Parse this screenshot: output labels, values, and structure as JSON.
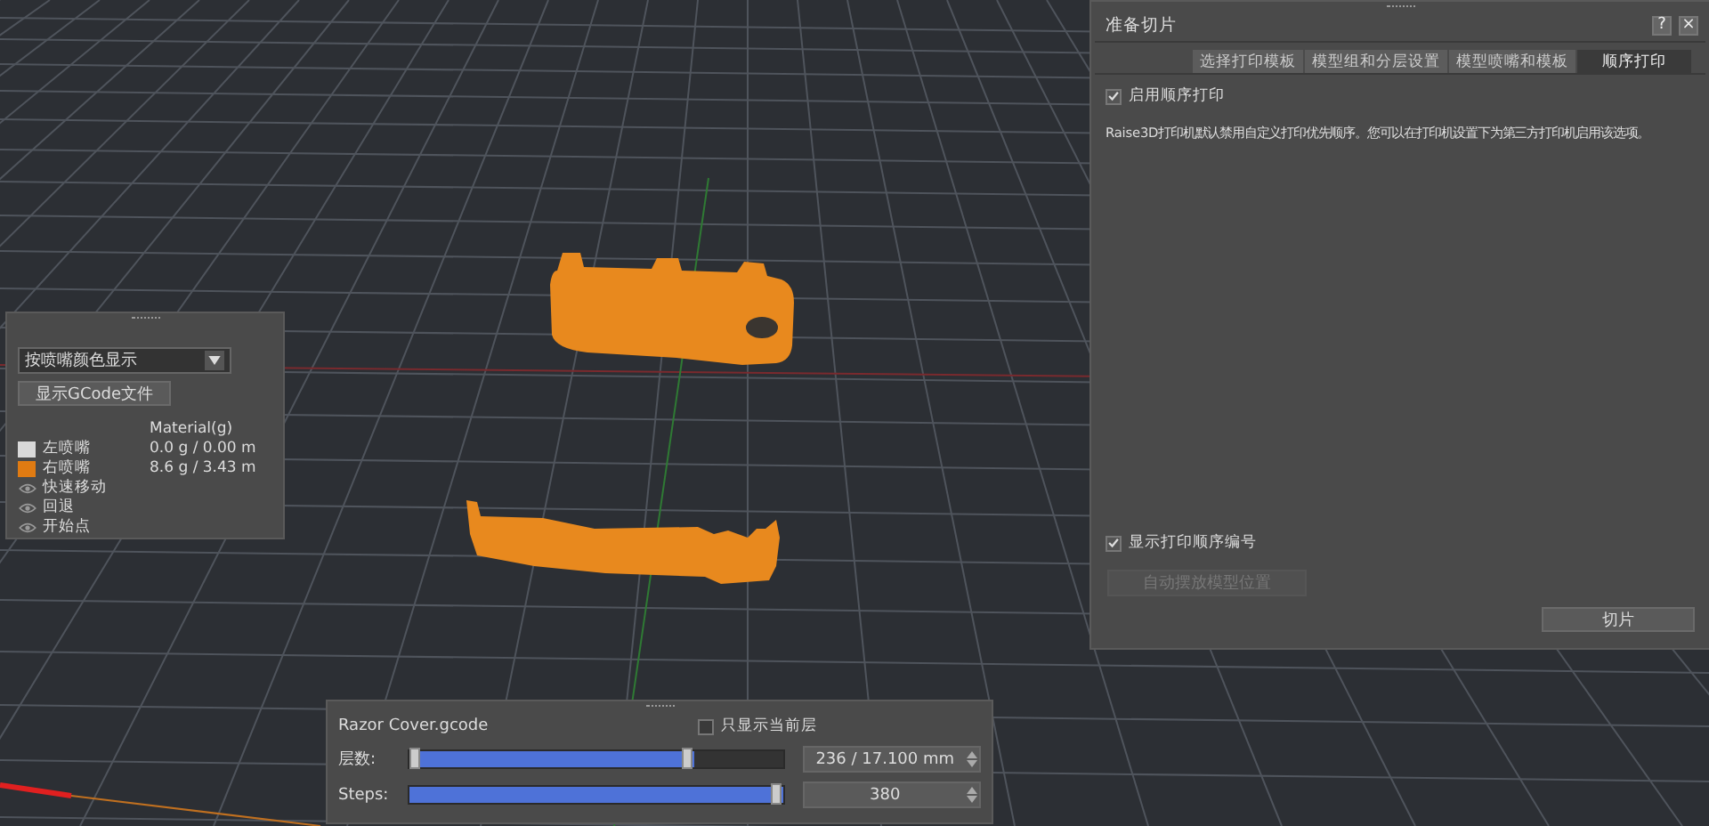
{
  "legend_panel": {
    "dropdown": {
      "value": "按喷嘴颜色显示"
    },
    "button": "显示GCode文件",
    "material_header": "Material(g)",
    "items": [
      {
        "kind": "swatch",
        "label": "左喷嘴",
        "color": "#d9d9d9",
        "value": "0.0 g / 0.00 m"
      },
      {
        "kind": "swatch",
        "label": "右喷嘴",
        "color": "#e07b12",
        "value": "8.6 g / 3.43 m"
      },
      {
        "kind": "eye",
        "label": "快速移动"
      },
      {
        "kind": "eye",
        "label": "回退"
      },
      {
        "kind": "eye",
        "label": "开始点"
      }
    ]
  },
  "slice_panel": {
    "title": "准备切片",
    "help": "?",
    "close": "×",
    "tabs": [
      {
        "label": "选择打印模板",
        "selected": false
      },
      {
        "label": "模型组和分层设置",
        "selected": false
      },
      {
        "label": "模型喷嘴和模板",
        "selected": false
      },
      {
        "label": "顺序打印",
        "selected": true
      }
    ],
    "sequence_checkbox": {
      "label": "启用顺序打印",
      "checked": true
    },
    "description": "Raise3D打印机默认禁用自定义打印优先顺序。您可以在打印机设置下为第三方打印机启用该选项。",
    "number_checkbox": {
      "label": "显示打印顺序编号",
      "checked": true
    },
    "auto_place_button": {
      "label": "自动摆放模型位置",
      "disabled": true
    },
    "slice_button": "切片"
  },
  "layer_panel": {
    "file": "Razor Cover.gcode",
    "current_layer_checkbox": {
      "label": "只显示当前层",
      "checked": false
    },
    "sliders": [
      {
        "label": "层数:",
        "level": 0.76,
        "reading": "236 / 17.100 mm"
      },
      {
        "label": "Steps:",
        "level": 1.0,
        "reading": "380"
      }
    ]
  }
}
